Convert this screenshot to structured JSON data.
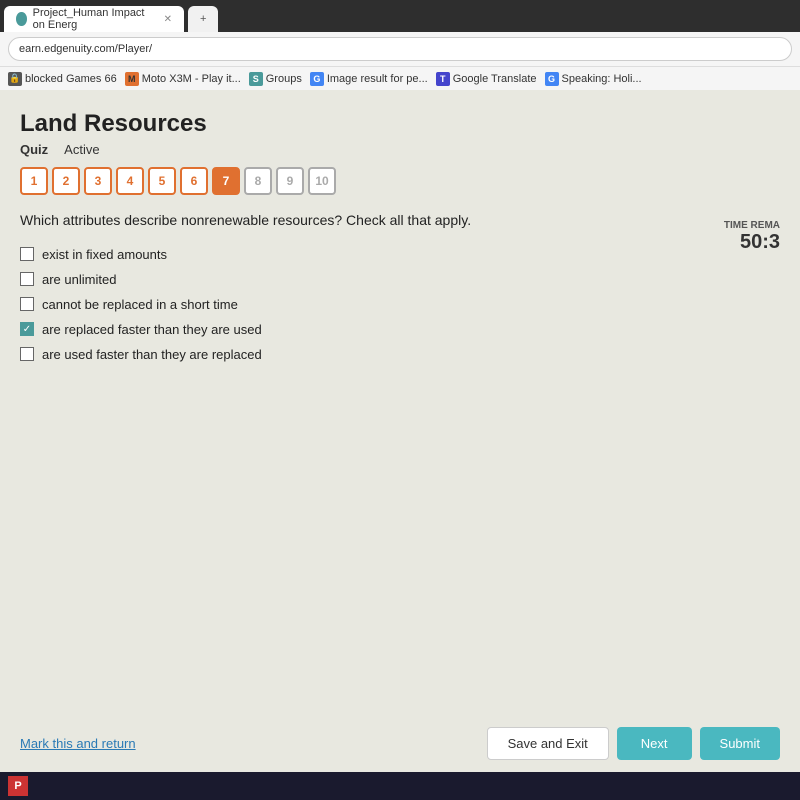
{
  "browser": {
    "address": "earn.edgenuity.com/Player/",
    "tabs": [
      {
        "label": "Project_Human Impact on Energ",
        "active": true
      },
      {
        "label": "...",
        "active": false
      }
    ]
  },
  "bookmarks": [
    {
      "name": "blocked-games",
      "label": "blocked Games 66",
      "color": "#555"
    },
    {
      "name": "moto-play",
      "label": "Moto X3M - Play it...",
      "color": "#e07030"
    },
    {
      "name": "groups",
      "label": "Groups",
      "color": "#4a9a9a"
    },
    {
      "name": "image-result",
      "label": "Image result for pe...",
      "color": "#4285f4"
    },
    {
      "name": "google-translate",
      "label": "Google Translate",
      "color": "#4444cc"
    },
    {
      "name": "speaking",
      "label": "Speaking: Holi...",
      "color": "#4285f4"
    }
  ],
  "page": {
    "title": "Land Resources",
    "quiz_label": "Quiz",
    "status_label": "Active",
    "timer_label": "TIME REMA",
    "timer_value": "50:3"
  },
  "question_numbers": [
    {
      "num": "1",
      "state": "normal"
    },
    {
      "num": "2",
      "state": "normal"
    },
    {
      "num": "3",
      "state": "normal"
    },
    {
      "num": "4",
      "state": "normal"
    },
    {
      "num": "5",
      "state": "normal"
    },
    {
      "num": "6",
      "state": "normal"
    },
    {
      "num": "7",
      "state": "active"
    },
    {
      "num": "8",
      "state": "inactive"
    },
    {
      "num": "9",
      "state": "inactive"
    },
    {
      "num": "10",
      "state": "inactive"
    }
  ],
  "question": {
    "text": "Which attributes describe nonrenewable resources? Check all that apply.",
    "options": [
      {
        "id": "opt1",
        "text": "exist in fixed amounts",
        "checked": false
      },
      {
        "id": "opt2",
        "text": "are unlimited",
        "checked": false
      },
      {
        "id": "opt3",
        "text": "cannot be replaced in a short time",
        "checked": false
      },
      {
        "id": "opt4",
        "text": "are replaced faster than they are used",
        "checked": true
      },
      {
        "id": "opt5",
        "text": "are used faster than they are replaced",
        "checked": false
      }
    ]
  },
  "buttons": {
    "mark_link": "Mark this and return",
    "save_exit": "Save and Exit",
    "next": "Next",
    "submit": "Submit"
  }
}
